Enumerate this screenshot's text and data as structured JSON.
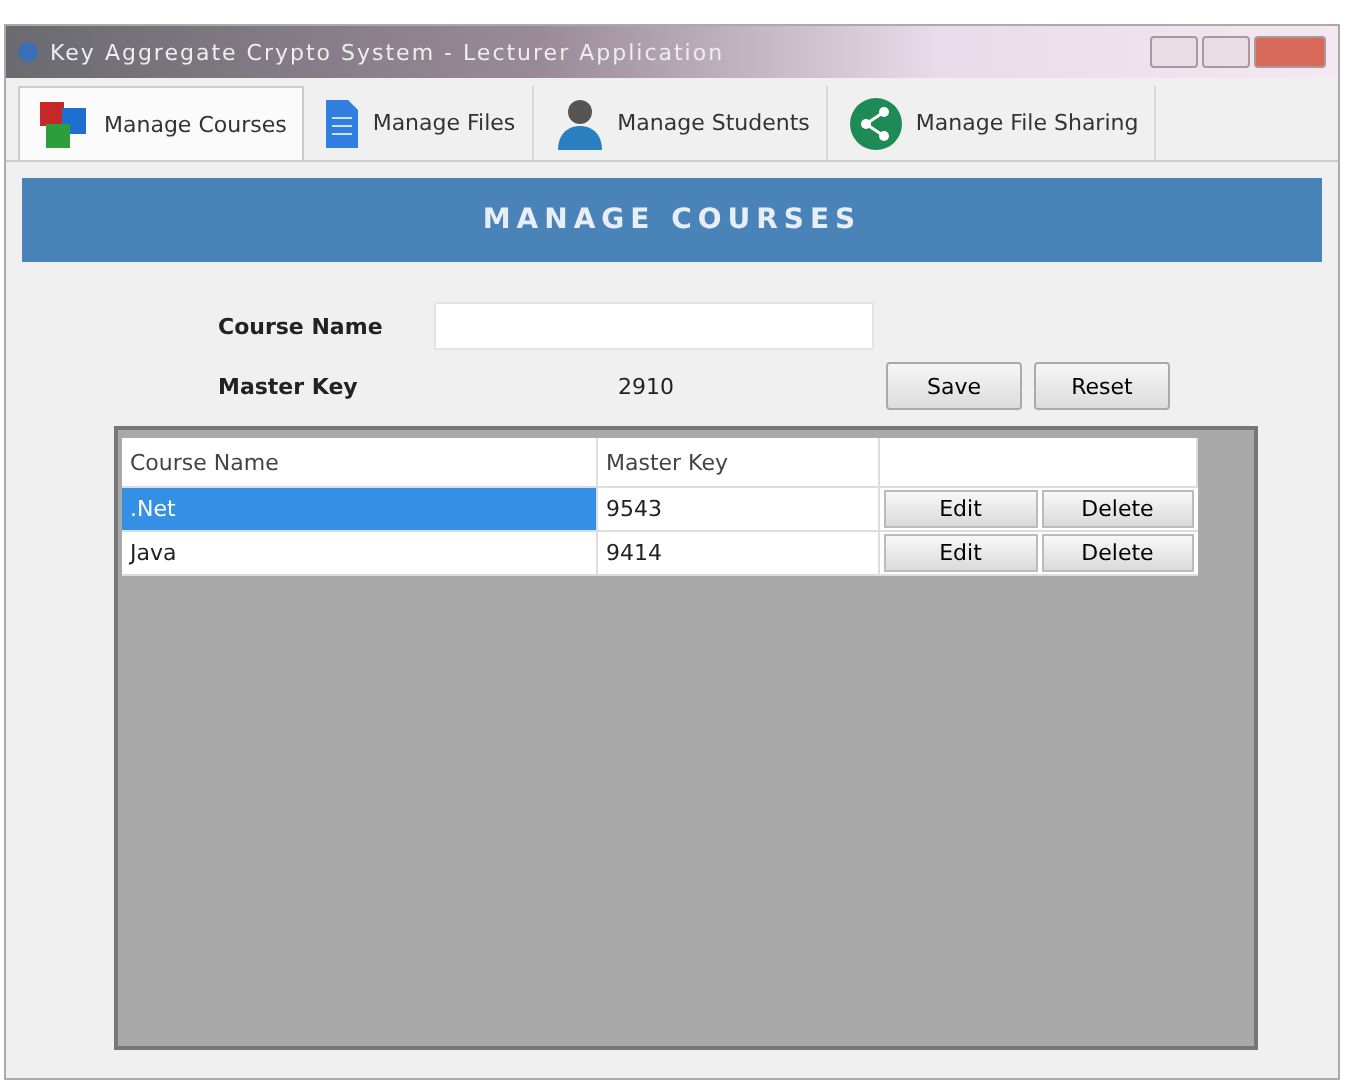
{
  "window": {
    "title": "Key Aggregate Crypto System - Lecturer Application"
  },
  "tabs": [
    {
      "label": "Manage Courses",
      "kind": "blocks",
      "selected": true
    },
    {
      "label": "Manage Files",
      "kind": "file",
      "selected": false
    },
    {
      "label": "Manage Students",
      "kind": "person",
      "selected": false
    },
    {
      "label": "Manage File Sharing",
      "kind": "share",
      "selected": false
    }
  ],
  "banner": "MANAGE COURSES",
  "form": {
    "course_name_label": "Course Name",
    "master_key_label": "Master Key",
    "master_key_value": "2910",
    "buttons": [
      "Save",
      "Reset"
    ]
  },
  "table": {
    "columns": [
      "Course Name",
      "Master Key"
    ],
    "rows": [
      {
        "course_name": ".Net",
        "master_key": "9543",
        "selected": true,
        "actions": [
          "Edit",
          "Delete"
        ]
      },
      {
        "course_name": "Java",
        "master_key": "9414",
        "selected": false,
        "actions": [
          "Edit",
          "Delete"
        ]
      }
    ]
  }
}
